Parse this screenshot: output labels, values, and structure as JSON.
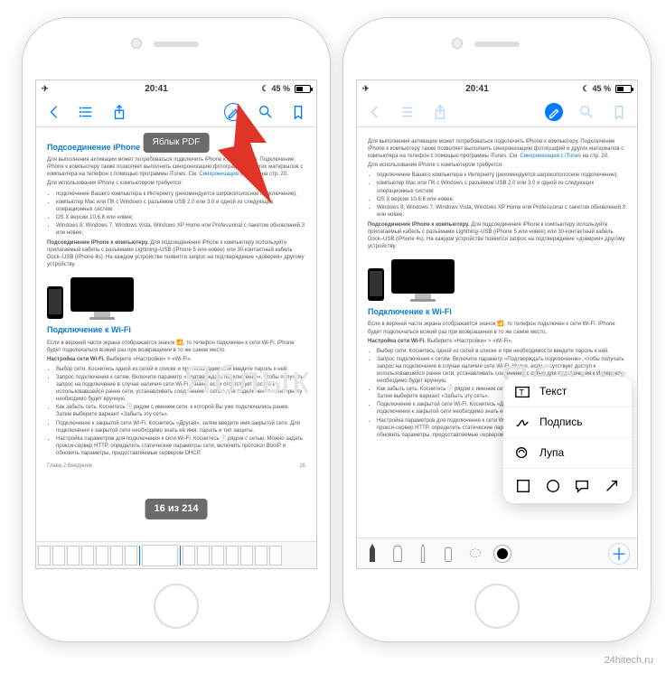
{
  "status": {
    "time": "20:41",
    "battery_text": "45 %"
  },
  "toolbar": {},
  "left": {
    "tooltip_title": "Яблык PDF",
    "page_indicator": "16 из 214",
    "footer_left": "Глава 2   Введение",
    "footer_right": "16"
  },
  "doc": {
    "h1": "Подсоединение iPhone",
    "p1": "Для выполнения активации может потребоваться подключить iPhone к компьютеру. Подключение iPhone к компьютеру также позволяет выполнить синхронизацию фотографий и других материалов с компьютера на телефон с помощью программы iTunes. См.",
    "link1": "Синхронизация с iTunes",
    "link1_tail": " на стр. 20.",
    "p2": "Для использования iPhone с компьютером требуется:",
    "b1": "подключение Вашего компьютера к Интернету (рекомендуется широкополосное подключение);",
    "b2": "компьютер Mac или ПК с Windows с разъёмом USB 2.0 или 3.0 и одной из следующих операционных систем:",
    "b3": "OS X версии 10.6.8 или новее;",
    "b4": "Windows 8, Windows 7, Windows Vista, Windows XP Home или Professional с пакетом обновлений 3 или новее;",
    "p3_strong": "Подсоединение iPhone к компьютеру.",
    "p3": " Для подсоединения iPhone к компьютеру используйте прилагаемый кабель с разъёмами Lightning–USB (iPhone 5 или новее) или 30-контактный кабель Dock–USB (iPhone 4s). На каждом устройстве появится запрос на подтверждение «доверия» другому устройству.",
    "h2": "Подключение к Wi-Fi",
    "p4": "Если в верхней части экрана отображается значок 📶, то телефон подключен к сети Wi-Fi. iPhone будет подключаться всякий раз при возвращении в то же самое место.",
    "p5_strong": "Настройка сети Wi-Fi.",
    "p5": " Выберите «Настройки» > «Wi-Fi».",
    "c1": "Выбор сети. Коснитесь одной из сетей в списке и при необходимости введите пароль к ней.",
    "c2": "Запрос подключения к сетям. Включите параметр «Подтверждать подключение», чтобы получать запрос на подключение в случае наличия сети Wi-Fi. Иначе, если отсутствует доступ к использовавшейся ранее сети, устанавливать соединение с сетью для подключения к Интернету необходимо будет вручную.",
    "c3": "Как забыть сеть. Коснитесь ⓘ рядом с именем сети, к которой Вы уже подключались ранее. Затем выберите вариант «Забыть эту сеть».",
    "c4": "Подключение к закрытой сети Wi-Fi. Коснитесь «Другая», затем введите имя закрытой сети. Для подключения к закрытой сети необходимо знать её имя, пароль и тип защиты.",
    "c5": "Настройка параметров для подключения к сети Wi-Fi. Коснитесь ⓘ рядом с сетью. Можно задать прокси-сервер HTTP, определить статические параметры сети, включить протокол BootP и обновить параметры, предоставляемые сервером DHCP."
  },
  "popover": {
    "text": "Текст",
    "signature": "Подпись",
    "magnifier": "Лупа"
  },
  "watermark": "Яблык",
  "site": "24hitech.ru"
}
